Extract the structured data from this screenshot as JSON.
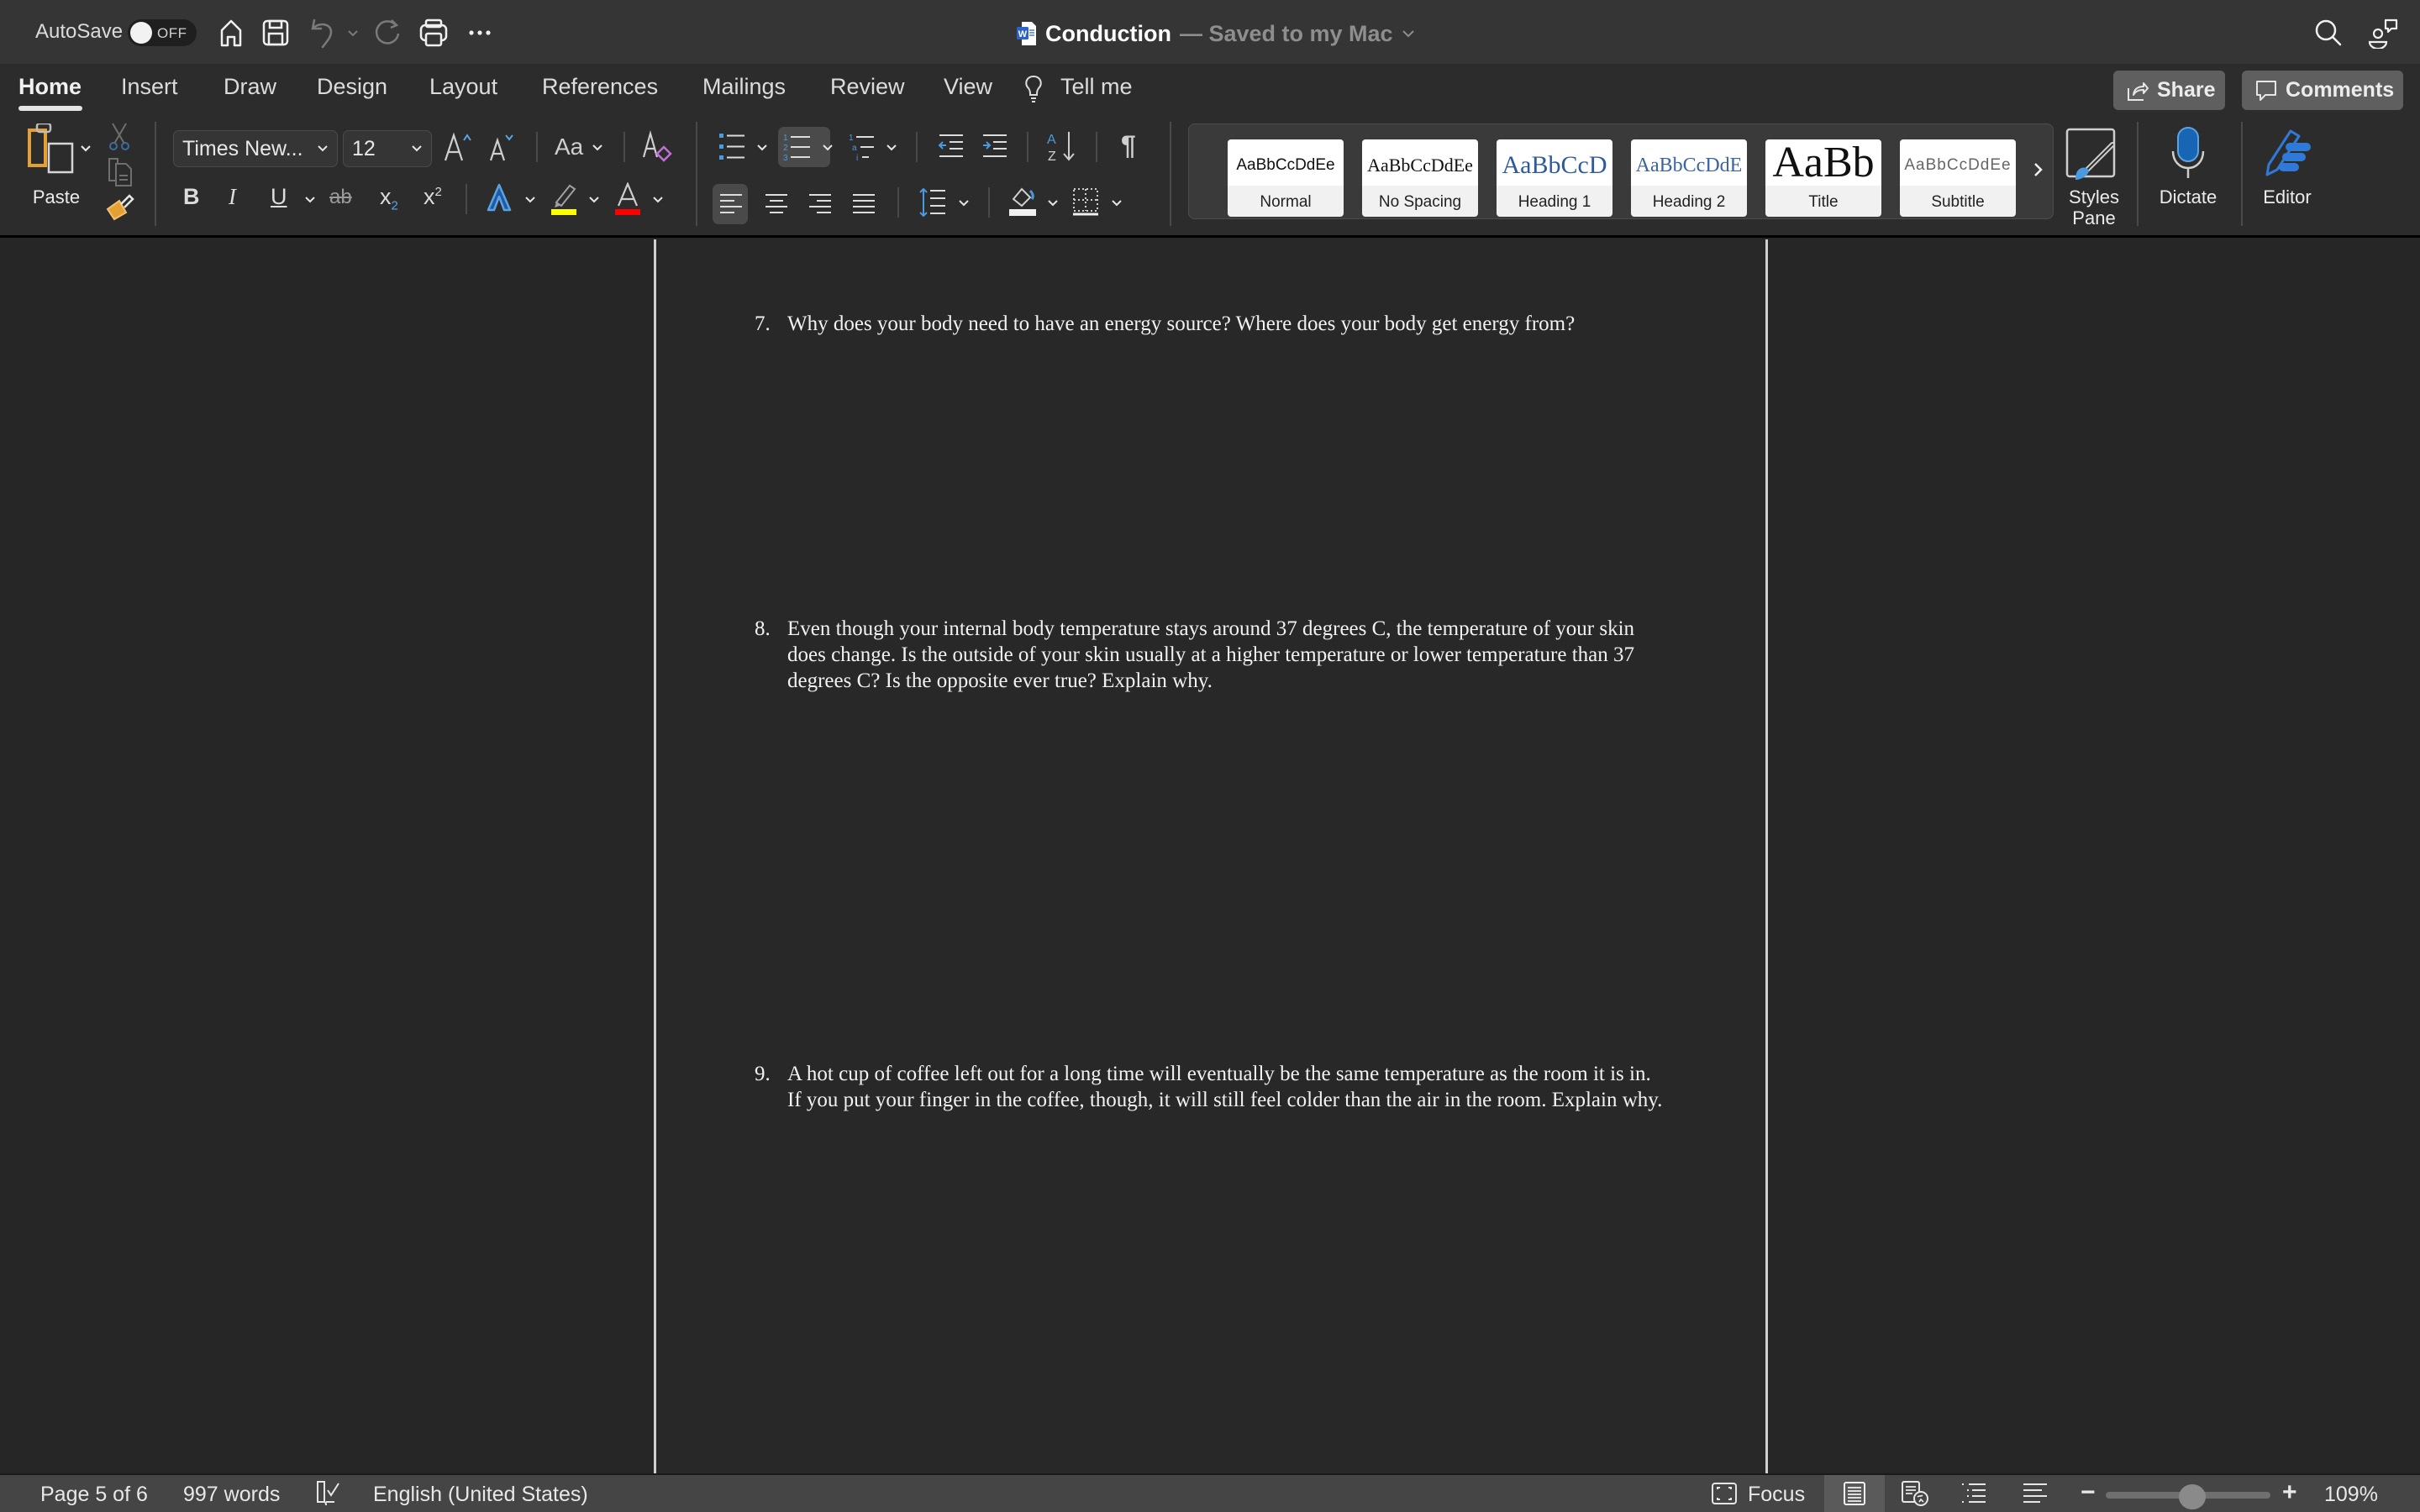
{
  "titlebar": {
    "autosave_label": "AutoSave",
    "autosave_state": "OFF",
    "doc_name": "Conduction",
    "doc_status": "— Saved to my Mac",
    "icons": [
      "home-icon",
      "save-icon",
      "undo-icon",
      "redo-icon",
      "print-icon",
      "more-icon",
      "search-icon",
      "collaborate-icon"
    ]
  },
  "tabs": [
    {
      "label": "Home",
      "active": true
    },
    {
      "label": "Insert"
    },
    {
      "label": "Draw"
    },
    {
      "label": "Design"
    },
    {
      "label": "Layout"
    },
    {
      "label": "References"
    },
    {
      "label": "Mailings"
    },
    {
      "label": "Review"
    },
    {
      "label": "View"
    }
  ],
  "tell_me": "Tell me",
  "share_label": "Share",
  "comments_label": "Comments",
  "ribbon": {
    "paste_label": "Paste",
    "font_name": "Times New...",
    "font_size": "12",
    "change_case": "Aa",
    "bold": "B",
    "italic": "I",
    "underline": "U",
    "strikethrough": "ab",
    "subscript": "x",
    "superscript": "x",
    "sub_mark": "2",
    "sup_mark": "2",
    "text_effects": "A",
    "font_color": "A",
    "highlight_color": "#ffff00",
    "font_color_value": "#ff0000",
    "pilcrow": "¶",
    "styles": [
      {
        "sample": "AaBbCcDdEe",
        "label": "Normal"
      },
      {
        "sample": "AaBbCcDdEe",
        "label": "No Spacing"
      },
      {
        "sample": "AaBbCcD",
        "label": "Heading 1"
      },
      {
        "sample": "AaBbCcDdE",
        "label": "Heading 2"
      },
      {
        "sample": "AaBb",
        "label": "Title"
      },
      {
        "sample": "AaBbCcDdEe",
        "label": "Subtitle"
      }
    ],
    "styles_pane_label": "Styles Pane",
    "dictate_label": "Dictate",
    "editor_label": "Editor"
  },
  "document": {
    "questions": [
      {
        "number": "7.",
        "lines": [
          "Why does your body need to have an energy source? Where does your body get energy from?"
        ]
      },
      {
        "number": "8.",
        "lines": [
          "Even though your internal body temperature stays around 37 degrees C, the temperature of your skin",
          "does change. Is the outside of your skin usually at a higher temperature or lower temperature than 37",
          "degrees C? Is the opposite ever true? Explain why."
        ]
      },
      {
        "number": "9.",
        "lines": [
          "A hot cup of coffee left out for a long time will eventually be the same temperature as the room it is in.",
          "If you put your finger in the coffee, though, it will still feel colder than the air in the room. Explain why."
        ]
      }
    ]
  },
  "statusbar": {
    "page": "Page 5 of 6",
    "words": "997 words",
    "language": "English (United States)",
    "focus_label": "Focus",
    "zoom_minus": "−",
    "zoom_plus": "+",
    "zoom_level": "109%",
    "zoom_percent": 109
  }
}
